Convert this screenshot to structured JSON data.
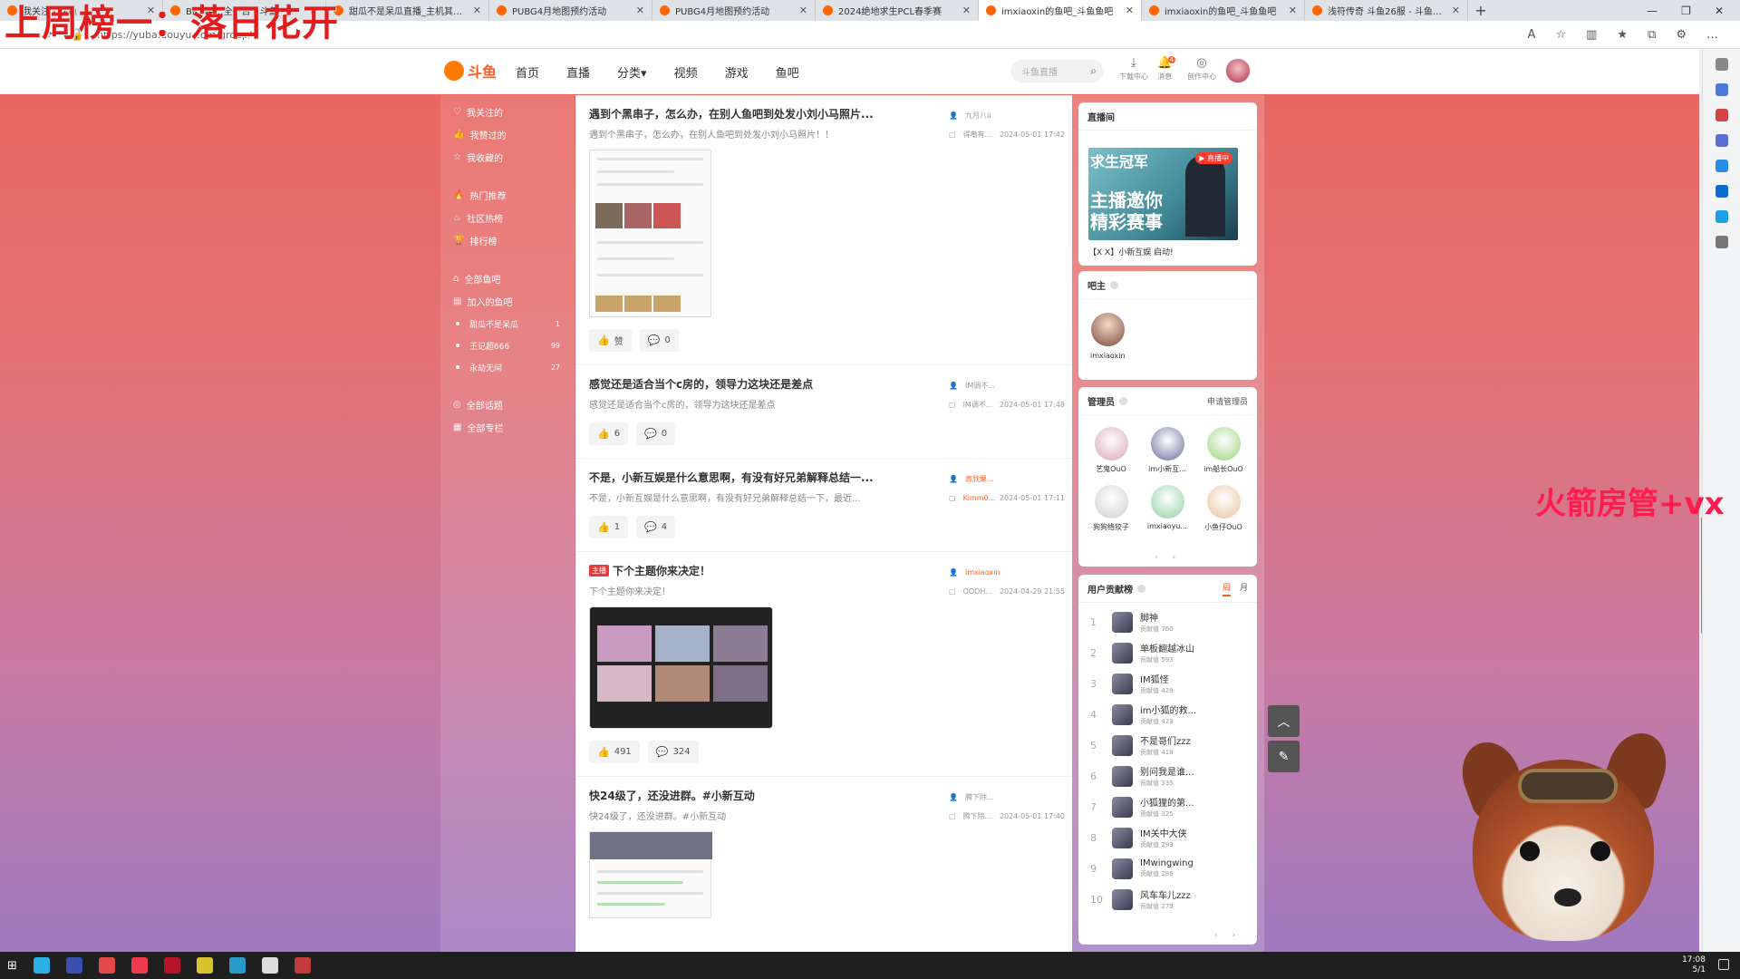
{
  "browser": {
    "tabs": [
      {
        "title": "我关注 - 斗鱼",
        "active": false
      },
      {
        "title": "BR wp…全平台 - 斗鱼",
        "active": false
      },
      {
        "title": "甜瓜不是呆瓜直播_主机其他游戏",
        "active": false
      },
      {
        "title": "PUBG4月地图预约活动",
        "active": false
      },
      {
        "title": "PUBG4月地图预约活动",
        "active": false
      },
      {
        "title": "2024绝地求生PCL春季赛",
        "active": false
      },
      {
        "title": "imxiaoxin的鱼吧_斗鱼鱼吧",
        "active": true
      },
      {
        "title": "imxiaoxin的鱼吧_斗鱼鱼吧",
        "active": false
      },
      {
        "title": "浅符传奇 斗鱼26服 - 斗鱼游戏中",
        "active": false
      }
    ],
    "url": "https://yuba.douyu.com/group/"
  },
  "header": {
    "logo_text": "斗鱼",
    "nav": [
      "首页",
      "直播",
      "分类▾",
      "视频",
      "游戏",
      "鱼吧"
    ],
    "search_placeholder": "斗鱼直播",
    "utils": [
      {
        "label": "下载中心",
        "icon": "download-icon"
      },
      {
        "label": "消息",
        "icon": "bell-icon",
        "badge": "4"
      },
      {
        "label": "创作中心",
        "icon": "bulb-icon"
      }
    ]
  },
  "left_menu": {
    "group1": [
      {
        "label": "我关注的",
        "icon": "heart-icon"
      },
      {
        "label": "我赞过的",
        "icon": "thumb-icon"
      },
      {
        "label": "我收藏的",
        "icon": "star-icon"
      }
    ],
    "group2": [
      {
        "label": "热门推荐",
        "icon": "fire-icon"
      },
      {
        "label": "社区热榜",
        "icon": "flame-icon"
      },
      {
        "label": "排行榜",
        "icon": "trophy-icon"
      }
    ],
    "group3": [
      {
        "label": "全部鱼吧",
        "icon": "home-icon"
      },
      {
        "label": "加入的鱼吧",
        "icon": "doc-icon"
      }
    ],
    "joined": [
      {
        "label": "甜瓜不是呆瓜",
        "count": "1"
      },
      {
        "label": "王记超666",
        "count": "99"
      },
      {
        "label": "永劫无间",
        "count": "27"
      }
    ],
    "group4": [
      {
        "label": "全部话题",
        "icon": "topic-icon"
      },
      {
        "label": "全部专栏",
        "icon": "column-icon"
      }
    ]
  },
  "posts": [
    {
      "title": "遇到个黑串子，怎么办，在别人鱼吧到处发小刘小马照片...",
      "summary": "遇到个黑串子，怎么办，在别人鱼吧到处发小刘小马照片！！",
      "author": "九月八ii",
      "last_reply": "得嘞有...",
      "time": "2024-05-01 17:42",
      "like": "赞",
      "comments": "0",
      "host": false
    },
    {
      "title": "感觉还是适合当个c房的，领导力这块还是差点",
      "summary": "感觉还是适合当个c房的，领导力这块还是差点",
      "author": "IM调不...",
      "last_reply": "IM调不...",
      "time": "2024-05-01 17:48",
      "like": "6",
      "comments": "0",
      "host": false
    },
    {
      "title": "不是，小新互娱是什么意思啊，有没有好兄弟解释总结一...",
      "summary": "不是，小新互娱是什么意思啊，有没有好兄弟解释总结一下，最近...",
      "author": "肯欣果...",
      "last_reply": "Kimm0...",
      "time": "2024-05-01 17:11",
      "like": "1",
      "comments": "4",
      "host": false
    },
    {
      "title": "下个主题你来决定！",
      "summary": "下个主题你来决定！",
      "author": "imxiaoxin",
      "last_reply": "OOOH...",
      "time": "2024-04-29 21:55",
      "like": "491",
      "comments": "324",
      "host": true,
      "host_tag": "主播"
    },
    {
      "title": "快24级了，还没进群。#小新互动",
      "summary": "快24级了，还没进群。#小新互动",
      "author": "腾下除...",
      "last_reply": "腾下除...",
      "time": "2024-05-01 17:40",
      "host": false
    }
  ],
  "right": {
    "live": {
      "title": "直播间",
      "img_text1": "求生冠军",
      "img_text2": "主播邀你\n精彩赛事",
      "badge": "直播中",
      "caption": "【X X】小新互娱 启动!"
    },
    "owner": {
      "title": "吧主",
      "name": "imxiaoxin"
    },
    "mods": {
      "title": "管理员",
      "apply": "申请管理员",
      "list": [
        "艺鬼OuO",
        "im小新互...",
        "im船长OuO",
        "狗狗络狡子",
        "imxiaoyu...",
        "小鱼仔OuO"
      ]
    },
    "ranking": {
      "title": "用户贡献榜",
      "tabs": [
        "周",
        "月"
      ],
      "score_label": "贡献值",
      "list": [
        {
          "rank": "1",
          "name": "脚神",
          "score": "760"
        },
        {
          "rank": "2",
          "name": "单板翻越冰山",
          "score": "593"
        },
        {
          "rank": "3",
          "name": "IM狐怪",
          "score": "428"
        },
        {
          "rank": "4",
          "name": "im小狐的救...",
          "score": "423"
        },
        {
          "rank": "5",
          "name": "不是哥们zzz",
          "score": "418"
        },
        {
          "rank": "6",
          "name": "别问我是谁...",
          "score": "335"
        },
        {
          "rank": "7",
          "name": "小狐狸的第...",
          "score": "325"
        },
        {
          "rank": "8",
          "name": "IM关中大侠",
          "score": "293"
        },
        {
          "rank": "9",
          "name": "IMwingwing",
          "score": "286"
        },
        {
          "rank": "10",
          "name": "风车车儿zzz",
          "score": "279"
        }
      ]
    }
  },
  "overlays": {
    "title": "上周榜一：落日花开",
    "side": "火箭房管+vx"
  },
  "taskbar": {
    "time": "17:08",
    "date": "5/1"
  },
  "colors": {
    "accent": "#ff5d23",
    "overlay_red": "#e11d1d",
    "overlay_pink": "#ff1c4e"
  }
}
